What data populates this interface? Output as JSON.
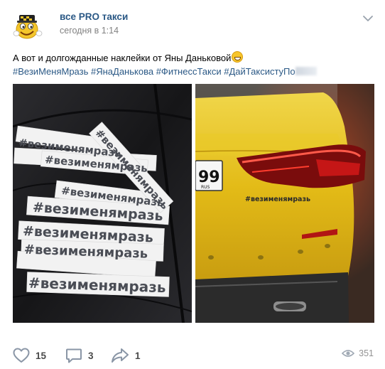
{
  "post": {
    "author": "все PRO такси",
    "time": "сегодня в 1:14",
    "text": "А вот и долгожданные наклейки от Яны Даньковой",
    "hashtags": [
      "#ВезиМеняМразь",
      "#ЯнаДанькова",
      "#ФитнессТакси",
      "#ДайТаксистуПо"
    ]
  },
  "photos": {
    "left": {
      "sticker_text": "#везименямразь"
    },
    "right": {
      "sticker_text": "#везименямразь",
      "plate_text": "99",
      "plate_country": "RUS"
    }
  },
  "footer": {
    "likes": "15",
    "comments": "3",
    "shares": "1",
    "views": "351"
  },
  "colors": {
    "link": "#2a5885",
    "icon": "#8a96a6",
    "taxi_yellow": "#e8c11c"
  },
  "icons": [
    "taxi-mascot-avatar",
    "chevron-down-icon",
    "heart-icon",
    "comment-icon",
    "share-icon",
    "eye-icon",
    "grin-emoji"
  ]
}
